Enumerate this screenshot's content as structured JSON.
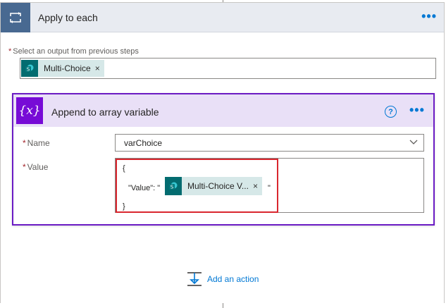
{
  "outer": {
    "title": "Apply to each",
    "more_label": "•••",
    "select_label": "Select an output from previous steps",
    "required_mark": "*",
    "token": {
      "text": "Multi-Choice",
      "remove": "×",
      "icon": "sharepoint-icon"
    }
  },
  "inner": {
    "title": "Append to array variable",
    "icon_text": "{x}",
    "help": "?",
    "more_label": "•••",
    "name_label": "Name",
    "name_value": "varChoice",
    "value_label": "Value",
    "value_lines": {
      "open": "{",
      "key": "\"Value\": \"",
      "close_quote": "\"",
      "close": "}"
    },
    "value_token": {
      "text": "Multi-Choice V...",
      "remove": "×",
      "icon": "sharepoint-icon"
    }
  },
  "footer": {
    "add_action": "Add an action"
  },
  "colors": {
    "loop_header": "#486991",
    "variable_icon": "#770bd6",
    "variable_border": "#6b1bc4",
    "sharepoint": "#036c70",
    "accent": "#0078d4",
    "highlight": "#d9262e"
  }
}
